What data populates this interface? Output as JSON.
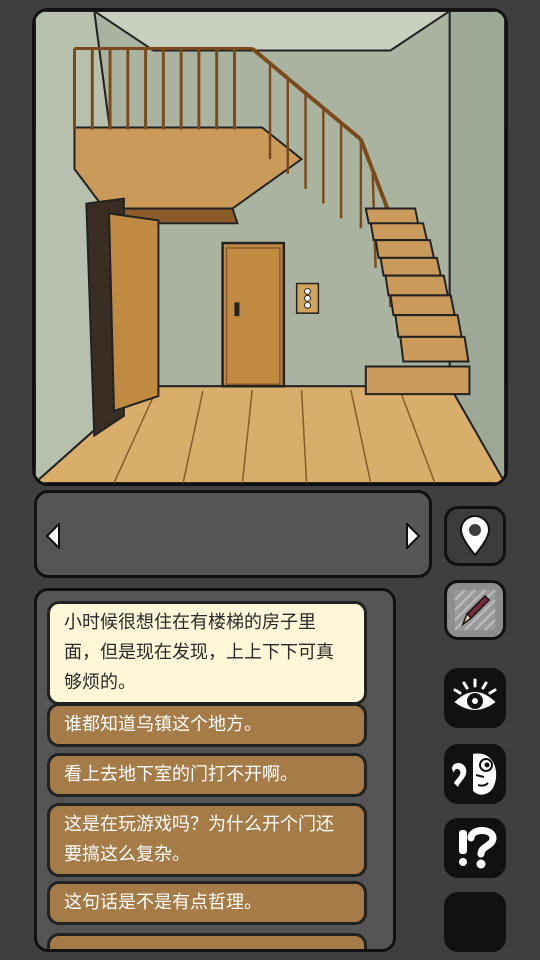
{
  "scene": {
    "name": "Hallway with staircase",
    "colors": {
      "wall": "#a9b3a0",
      "floor": "#d8ae6a",
      "door": "#c08a43",
      "stairs": "#c99a5a"
    }
  },
  "navigation": {
    "left_arrow_icon": "triangle-left-icon",
    "right_arrow_icon": "triangle-right-icon"
  },
  "side_buttons": [
    {
      "icon": "map-pin-icon"
    },
    {
      "icon": "pencil-icon"
    },
    {
      "icon": "eye-icon"
    },
    {
      "icon": "speech-face-icon"
    },
    {
      "icon": "exclamation-question-icon"
    },
    {
      "icon": "blank-icon"
    }
  ],
  "dialog": {
    "options": [
      {
        "text": "小时候很想住在有楼梯的房子里面，但是现在发现，上上下下可真够烦的。",
        "selected": true
      },
      {
        "text": "谁都知道乌镇这个地方。",
        "selected": false
      },
      {
        "text": "看上去地下室的门打不开啊。",
        "selected": false
      },
      {
        "text": "这是在玩游戏吗？为什么开个门还要搞这么复杂。",
        "selected": false
      },
      {
        "text": "这句话是不是有点哲理。",
        "selected": false
      }
    ]
  }
}
